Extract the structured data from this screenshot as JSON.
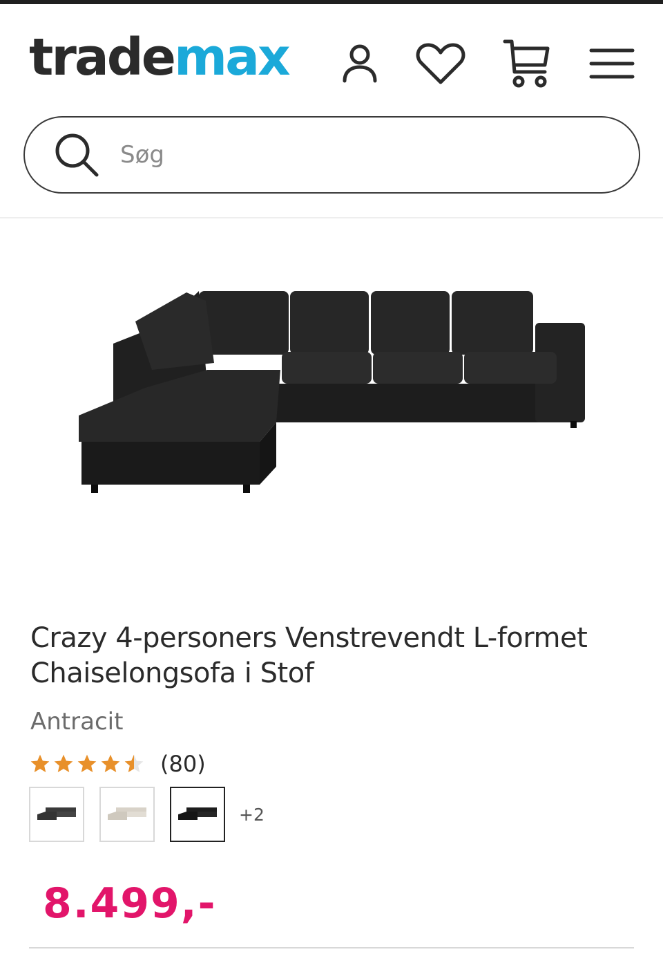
{
  "header": {
    "logo": {
      "part1": "trade",
      "part2": "max"
    },
    "icons": [
      "account-icon",
      "heart-icon",
      "cart-icon",
      "menu-icon"
    ],
    "search": {
      "placeholder": "Søg",
      "value": ""
    }
  },
  "product": {
    "title": "Crazy 4-personers Venstrevendt L-formet Chaiselongsofa i Stof",
    "variant": "Antracit",
    "rating": {
      "stars": 4.5,
      "max": 5,
      "count_label": "(80)"
    },
    "swatches": [
      {
        "name": "dark-grey-sofa",
        "selected": false
      },
      {
        "name": "beige-sofa",
        "selected": false
      },
      {
        "name": "anthracite-sofa",
        "selected": true
      }
    ],
    "more_swatches": "+2",
    "price": "8.499,-"
  },
  "colors": {
    "brand_dark": "#2b2b2b",
    "brand_blue": "#1ba9d9",
    "price": "#e2156a",
    "star": "#e8902a"
  }
}
